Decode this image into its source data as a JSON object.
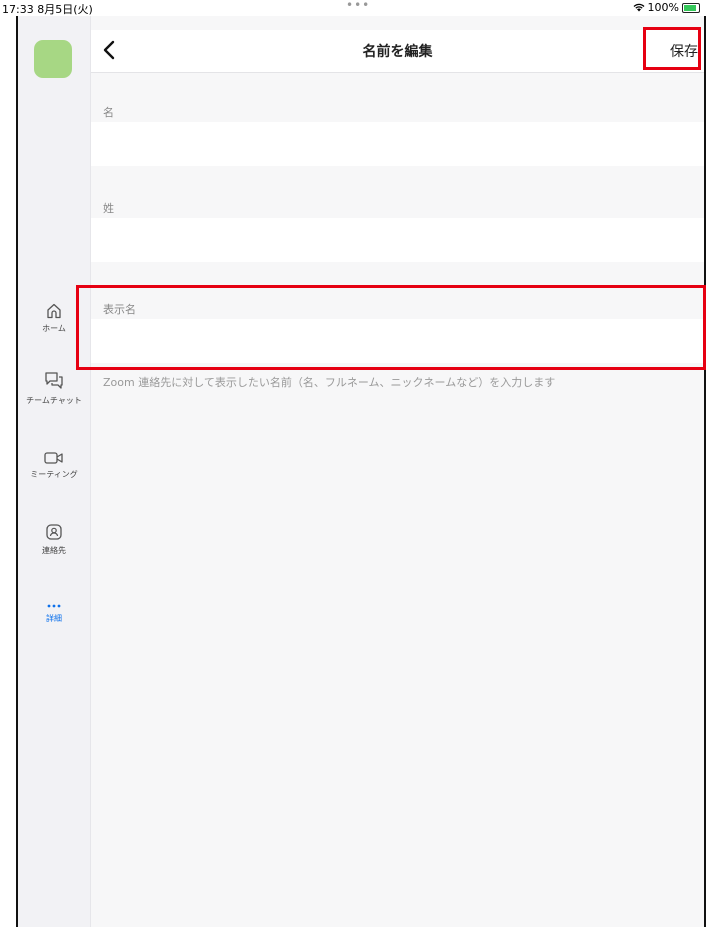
{
  "status": {
    "time": "17:33  8月5日(火)",
    "dots": "•••",
    "battery": "100%"
  },
  "sidebar": {
    "items": [
      {
        "label": "ホーム",
        "icon": "home-icon"
      },
      {
        "label": "チームチャット",
        "icon": "chat-icon"
      },
      {
        "label": "ミーティング",
        "icon": "video-camera-icon"
      },
      {
        "label": "連絡先",
        "icon": "contacts-icon"
      },
      {
        "label": "詳細",
        "icon": "more-icon"
      }
    ]
  },
  "header": {
    "title": "名前を編集",
    "save_label": "保存"
  },
  "form": {
    "first_name_label": "名",
    "first_name_value": "",
    "last_name_label": "姓",
    "last_name_value": "",
    "display_name_label": "表示名",
    "display_name_value": "",
    "helper": "Zoom 連絡先に対して表示したい名前（名、フルネーム、ニックネームなど）を入力します"
  },
  "colors": {
    "accent": "#0e71eb",
    "highlight": "#e60012",
    "avatar": "#a7d784"
  }
}
